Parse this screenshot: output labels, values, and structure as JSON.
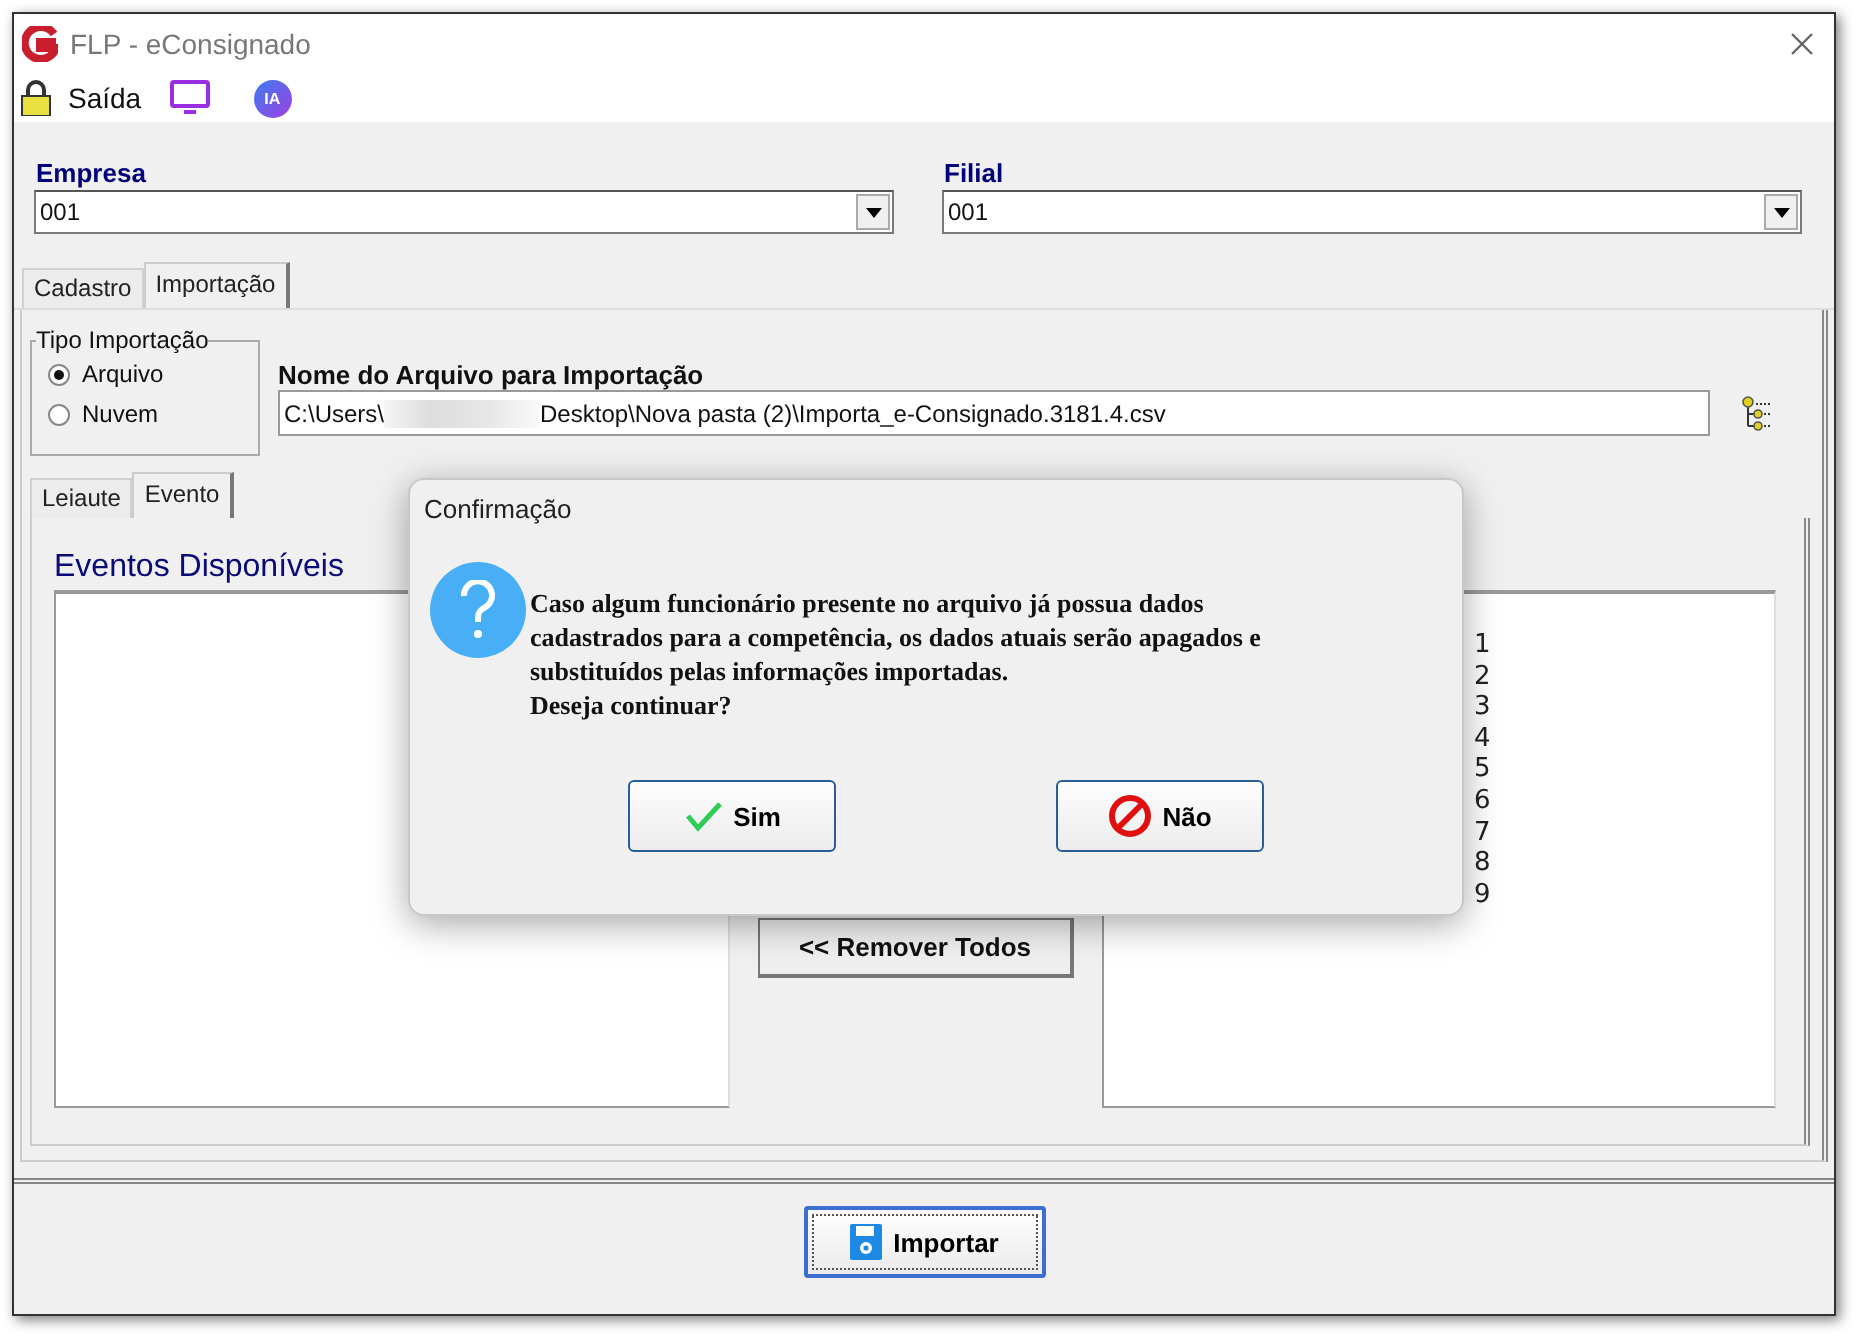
{
  "window": {
    "title": "FLP - eConsignado"
  },
  "toolbar": {
    "exit_label": "Saída",
    "ai_badge": "IA"
  },
  "empresa": {
    "label": "Empresa",
    "value": "001"
  },
  "filial": {
    "label": "Filial",
    "value": "001"
  },
  "tabs": [
    {
      "label": "Cadastro",
      "selected": false
    },
    {
      "label": "Importação",
      "selected": true
    }
  ],
  "import_type": {
    "title": "Tipo Importação",
    "options": [
      {
        "label": "Arquivo",
        "selected": true
      },
      {
        "label": "Nuvem",
        "selected": false
      }
    ]
  },
  "file": {
    "label": "Nome do Arquivo para Importação",
    "path_start": "C:\\Users\\",
    "path_end": "Desktop\\Nova pasta (2)\\Importa_e-Consignado.3181.4.csv"
  },
  "inner_tabs": [
    {
      "label": "Leiaute",
      "selected": false
    },
    {
      "label": "Evento",
      "selected": true
    }
  ],
  "available_events": {
    "title": "Eventos Disponíveis"
  },
  "remove_all_button": "<< Remover Todos",
  "selected_events": {
    "items": [
      "1",
      "2",
      "3",
      "4",
      "5",
      "6",
      "7",
      "8",
      "9"
    ]
  },
  "import_button": "Importar",
  "dialog": {
    "title": "Confirmação",
    "message_lines": [
      "Caso algum funcionário presente no arquivo já possua dados",
      "cadastrados para a competência, os dados atuais serão apagados e",
      "substituídos pelas informações importadas.",
      "Deseja continuar?"
    ],
    "buttons": [
      {
        "label": "Sim",
        "kind": "yes"
      },
      {
        "label": "Não",
        "kind": "no"
      }
    ]
  }
}
